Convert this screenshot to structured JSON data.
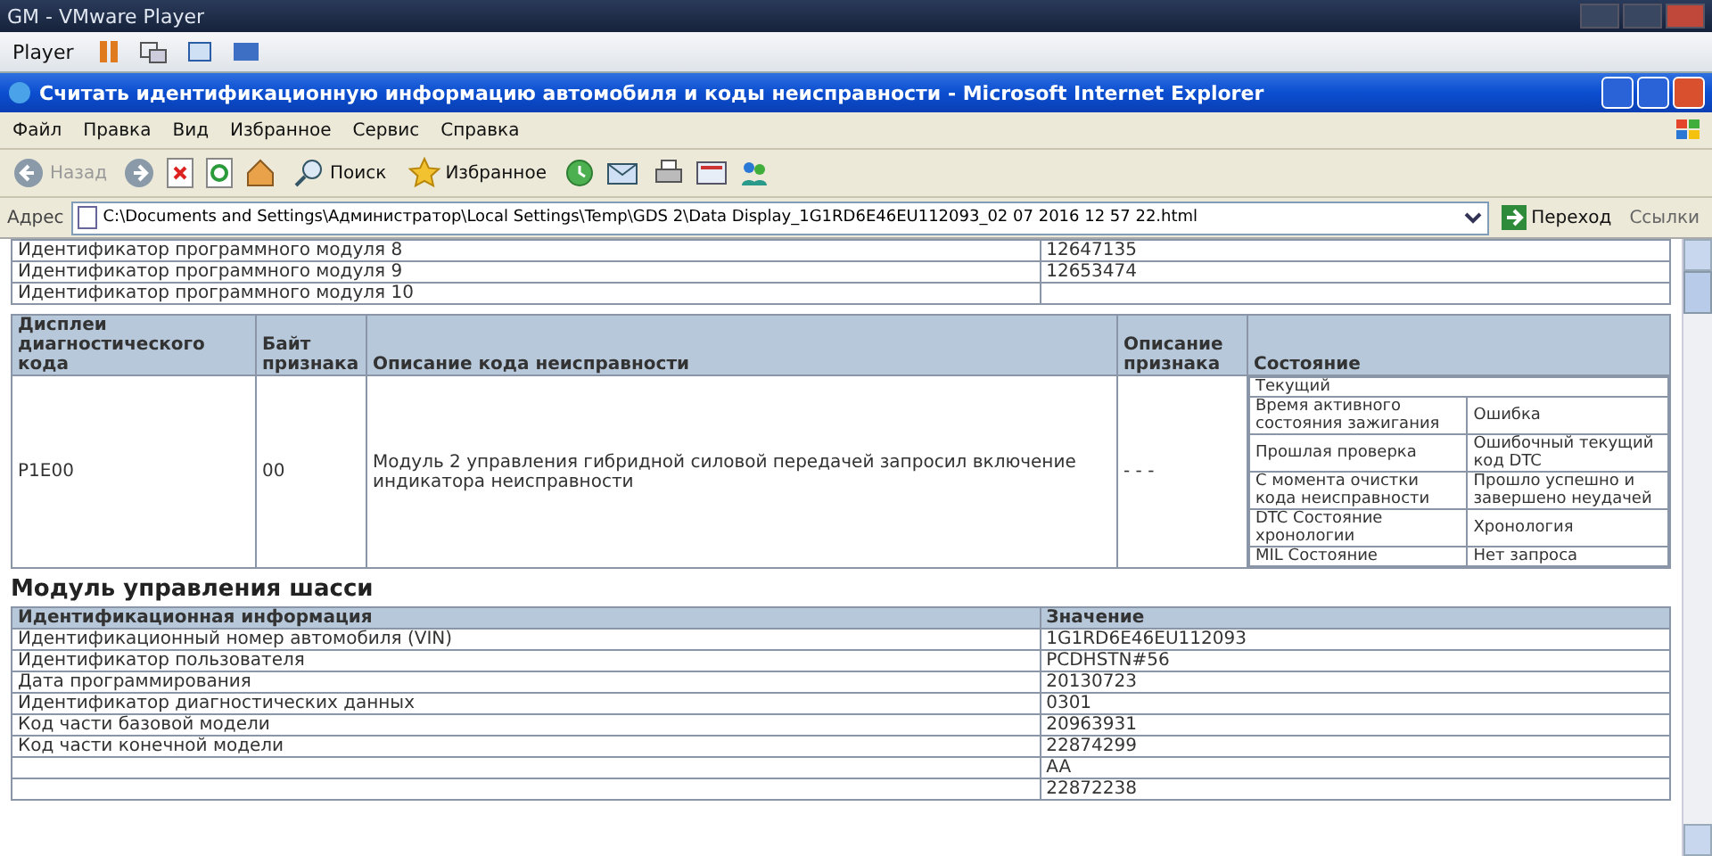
{
  "vmware": {
    "title": "GM - VMware Player",
    "menu": "Player"
  },
  "window": {
    "title": "Считать идентификационную информацию автомобиля и коды неисправности - Microsoft Internet Explorer"
  },
  "menu": [
    "Файл",
    "Правка",
    "Вид",
    "Избранное",
    "Сервис",
    "Справка"
  ],
  "toolbar": {
    "back": "Назад",
    "search": "Поиск",
    "favorites": "Избранное"
  },
  "address": {
    "label": "Адрес",
    "value": "C:\\Documents and Settings\\Администратор\\Local Settings\\Temp\\GDS 2\\Data Display_1G1RD6E46EU112093_02 07 2016 12 57 22.html",
    "go": "Переход",
    "links": "Ссылки"
  },
  "modules_table": [
    {
      "name": "Идентификатор программного модуля 8",
      "value": "12647135"
    },
    {
      "name": "Идентификатор программного модуля 9",
      "value": "12653474"
    },
    {
      "name": "Идентификатор программного модуля 10"
    }
  ],
  "dtc_table": {
    "columns": [
      "Дисплеи диагностического кода",
      "Байт признака",
      "Описание кода неисправности",
      "Описание признака",
      "Состояние"
    ],
    "rows": [
      {
        "code": "P1E00",
        "byte": "00",
        "description": "Модуль 2 управления гибридной силовой передачей запросил включение индикатора неисправности",
        "symptom": "- - -",
        "status_title": "Текущий",
        "status": [
          {
            "name": "Время активного состояния зажигания",
            "value": "Ошибка"
          },
          {
            "name": "Прошлая проверка",
            "value": "Ошибочный текущий код DTC"
          },
          {
            "name": "С момента очистки кода неисправности",
            "value": "Прошло успешно и завершено неудачей"
          },
          {
            "name": "DTC Состояние хронологии",
            "value": "Хронология"
          },
          {
            "name": "MIL Состояние",
            "value": "Нет запроса"
          }
        ]
      }
    ]
  },
  "chassis": {
    "heading": "Модуль управления шасси",
    "columns": [
      "Идентификационная информация",
      "Значение"
    ],
    "rows": [
      {
        "name": "Идентификационный номер автомобиля (VIN)",
        "value": "1G1RD6E46EU112093"
      },
      {
        "name": "Идентификатор пользователя",
        "value": "PCDHSTN#56"
      },
      {
        "name": "Дата программирования",
        "value": "20130723"
      },
      {
        "name": "Идентификатор диагностических данных",
        "value": "0301"
      },
      {
        "name": "Код части базовой модели",
        "value": "20963931"
      },
      {
        "name": "Код части конечной модели",
        "value": "22874299"
      },
      {
        "value": "AA"
      },
      {
        "value": "22872238"
      }
    ]
  }
}
